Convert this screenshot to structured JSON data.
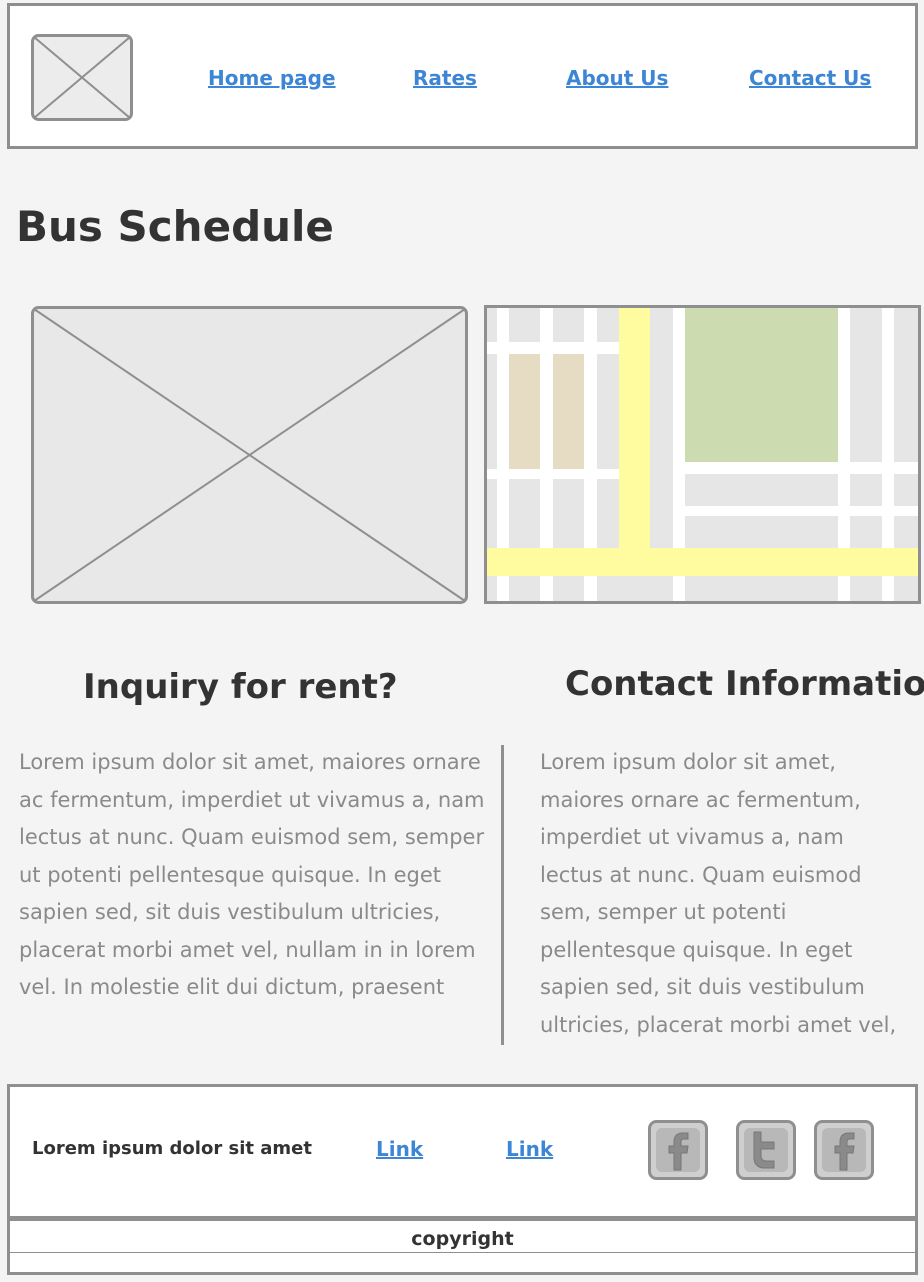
{
  "header": {
    "logo_icon": "image-placeholder-icon",
    "nav": [
      {
        "label": "Home page"
      },
      {
        "label": "Rates"
      },
      {
        "label": "About Us"
      },
      {
        "label": "Contact Us"
      }
    ]
  },
  "main": {
    "title": "Bus Schedule",
    "hero_icon": "image-placeholder-icon",
    "map_icon": "map-icon",
    "inquiry": {
      "heading": "Inquiry for rent?",
      "body": "Lorem ipsum dolor sit amet, maiores ornare ac fermentum, imperdiet ut vivamus a, nam lectus at nunc. Quam euismod sem, semper ut potenti pellentesque quisque. In eget sapien sed, sit duis vestibulum ultricies, placerat morbi amet vel, nullam in in lorem vel. In molestie elit dui dictum, praesent"
    },
    "contact": {
      "heading": "Contact Information",
      "body": "Lorem ipsum dolor sit amet, maiores ornare ac fermentum, imperdiet ut vivamus a, nam lectus at nunc. Quam euismod sem, semper ut potenti pellentesque quisque. In eget sapien sed, sit duis vestibulum ultricies, placerat morbi amet vel,"
    }
  },
  "footer": {
    "text": "Lorem ipsum dolor sit amet",
    "links": [
      {
        "label": "Link"
      },
      {
        "label": "Link"
      }
    ],
    "social_icons": [
      "facebook-icon",
      "twitter-icon",
      "facebook-icon"
    ],
    "copyright": "copyright"
  },
  "colors": {
    "link": "#3d86d6",
    "border": "#8f8f8f",
    "background": "#f4f4f4",
    "map_road": "#fffca0",
    "map_park": "#cddcb0",
    "map_building": "#e6dcc4"
  }
}
